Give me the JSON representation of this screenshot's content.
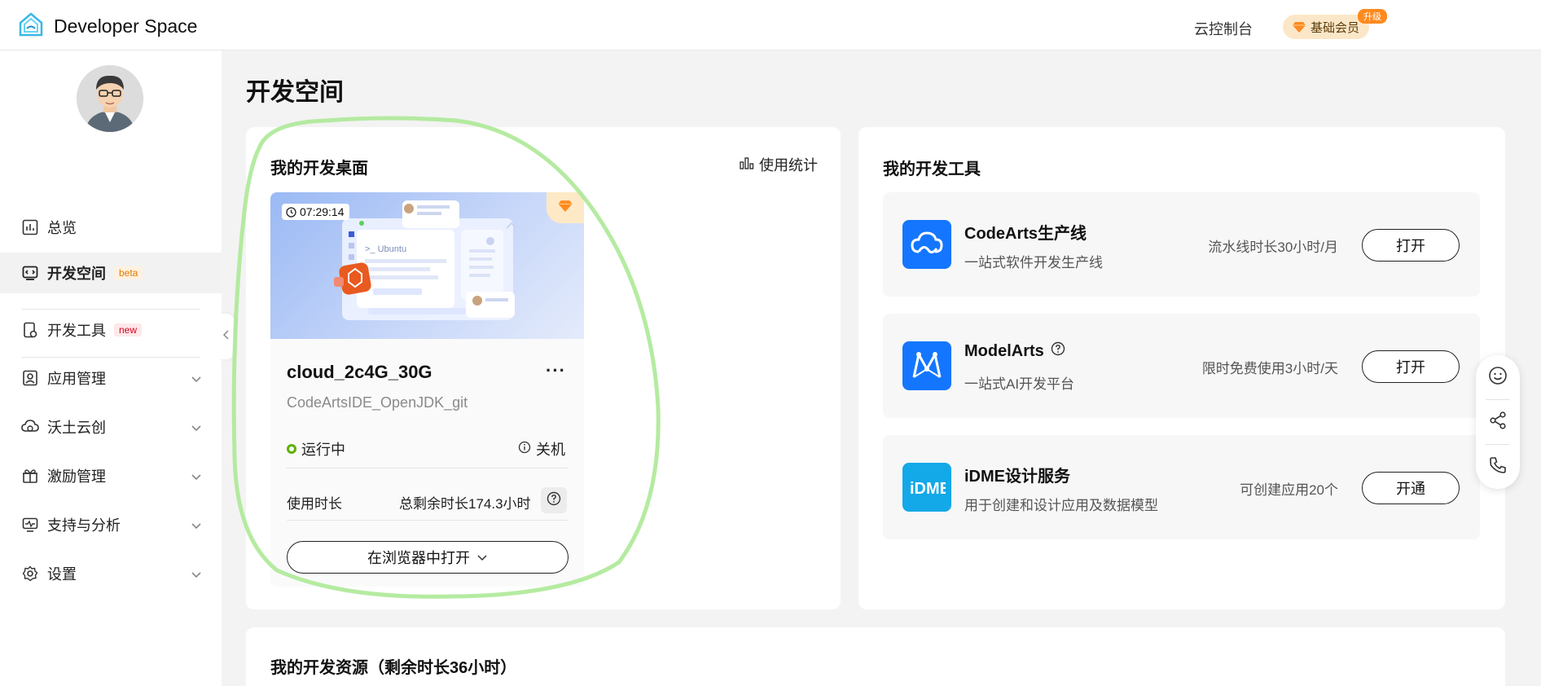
{
  "header": {
    "app_name": "Developer Space",
    "console_link": "云控制台",
    "member_badge": "基础会员",
    "upgrade_tag": "升级"
  },
  "sidebar": {
    "items": [
      {
        "label": "总览",
        "icon": "dashboard-icon"
      },
      {
        "label": "开发空间",
        "tag": "beta",
        "icon": "code-screen-icon",
        "active": true
      },
      {
        "label": "开发工具",
        "tag": "new",
        "icon": "tool-phone-icon"
      },
      {
        "label": "应用管理",
        "icon": "app-manage-icon",
        "expandable": true
      },
      {
        "label": "沃土云创",
        "icon": "cloud-icon",
        "expandable": true
      },
      {
        "label": "激励管理",
        "icon": "gift-icon",
        "expandable": true
      },
      {
        "label": "支持与分析",
        "icon": "monitor-icon",
        "expandable": true
      },
      {
        "label": "设置",
        "icon": "gear-icon",
        "expandable": true
      }
    ]
  },
  "main": {
    "page_title": "开发空间",
    "desktop_section": {
      "title": "我的开发桌面",
      "stats_link": "使用统计",
      "instance": {
        "timer": "07:29:14",
        "thumb_text": ">_ Ubuntu",
        "name": "cloud_2c4G_30G",
        "more": "···",
        "subtitle": "CodeArtsIDE_OpenJDK_git",
        "status": "运行中",
        "status_color": "#5cb300",
        "shutdown": "关机",
        "usage_label": "使用时长",
        "usage_value": "总剩余时长174.3小时",
        "open_button": "在浏览器中打开"
      }
    },
    "tools_section": {
      "title": "我的开发工具",
      "tools": [
        {
          "name": "CodeArts生产线",
          "desc": "一站式软件开发生产线",
          "quota": "流水线时长30小时/月",
          "button": "打开",
          "icon": "codearts-cloud-icon",
          "color": "#1476ff"
        },
        {
          "name": "ModelArts",
          "desc": "一站式AI开发平台",
          "quota": "限时免费使用3小时/天",
          "button": "打开",
          "icon": "modelarts-icon",
          "color": "#1476ff"
        },
        {
          "name": "iDME设计服务",
          "desc": "用于创建和设计应用及数据模型",
          "quota": "可创建应用20个",
          "button": "开通",
          "icon": "idme-icon",
          "color": "#13a8e8"
        }
      ]
    },
    "resources_section": {
      "title": "我的开发资源（剩余时长36小时）"
    }
  },
  "float_toolbar": [
    "smile-icon",
    "share-icon",
    "phone-icon"
  ]
}
